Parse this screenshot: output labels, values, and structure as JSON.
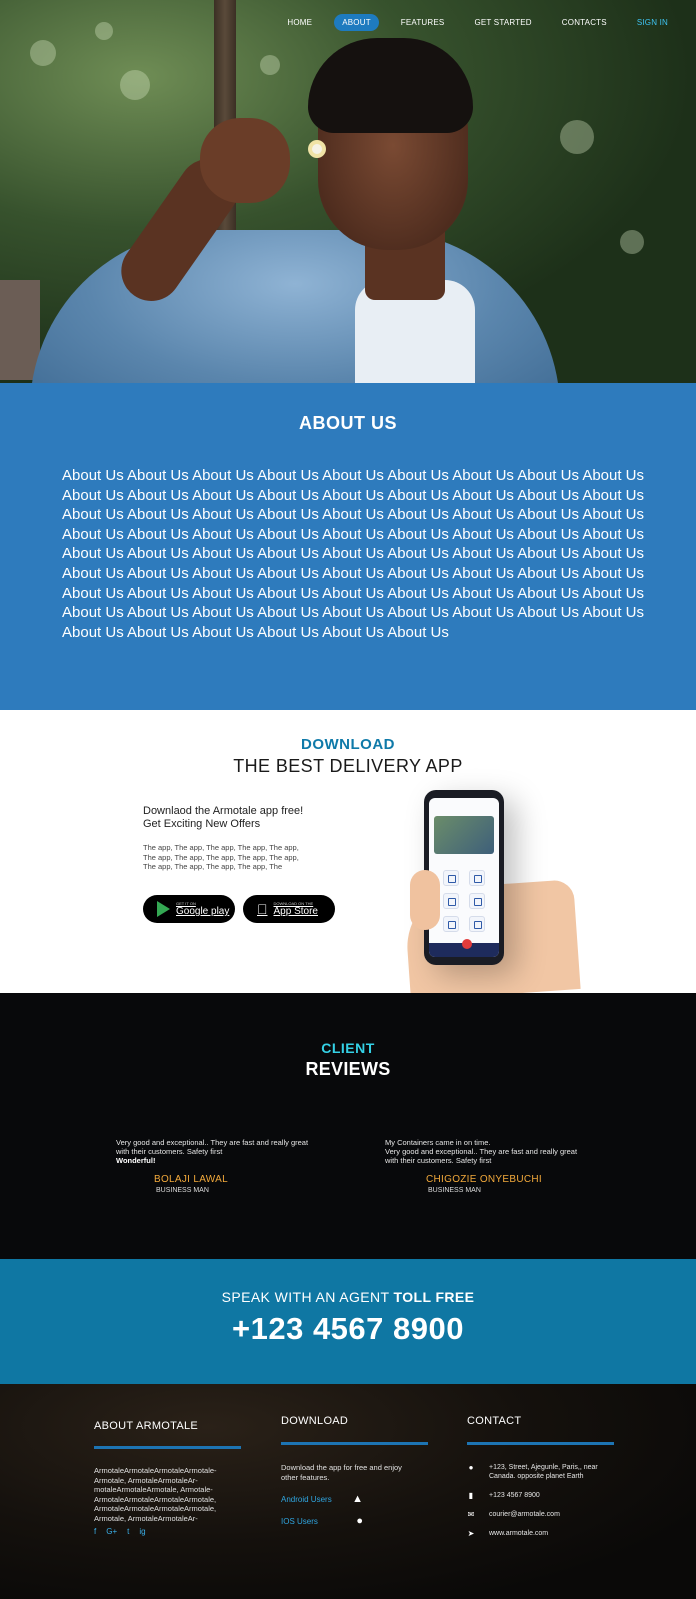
{
  "nav": {
    "items": [
      "HOME",
      "ABOUT",
      "FEATURES",
      "GET STARTED",
      "CONTACTS"
    ],
    "active": "ABOUT",
    "signin": "SIGN IN"
  },
  "about": {
    "title": "ABOUT US",
    "body": "About Us About Us About Us About Us About Us About Us About Us About Us About Us About Us About Us About Us About Us About Us About Us About Us About Us About Us About Us About Us About Us About Us About Us About Us About Us About Us About Us About Us About Us About Us About Us About Us About Us About Us About Us About Us About Us About Us About Us About Us About Us About Us About Us About Us About Us About Us About Us About Us About Us About Us About Us About Us About Us About Us About Us About Us About Us About Us About Us About Us About Us About Us About Us About Us About Us About Us About Us About Us About Us About Us About Us About Us About Us About Us About Us About Us About Us About Us"
  },
  "download": {
    "kicker": "DOWNLOAD",
    "headline": "THE BEST DELIVERY APP",
    "lead_1": "Downlaod the Armotale app free!",
    "lead_2": "Get Exciting New Offers",
    "small": "The app, The app, The app, The app, The app, The app, The app, The app, The app, The app, The app, The app, The app, The app, The",
    "google_small": "GET IT ON",
    "google_big": "Google play",
    "apple_small": "Download on the",
    "apple_big": "App Store"
  },
  "reviews": {
    "kicker": "CLIENT",
    "headline": "REVIEWS",
    "items": [
      {
        "text": "Very good and exceptional.. They are fast and really great with their customers. Safety first",
        "emph": "Wonderful!",
        "name": "BOLAJI LAWAL",
        "role": "BUSINESS MAN"
      },
      {
        "text_1": "My Containers came in on time.",
        "text": "Very good and exceptional.. They are fast and really great with their customers. Safety first",
        "name": "CHIGOZIE ONYEBUCHI",
        "role": "BUSINESS MAN"
      }
    ]
  },
  "call": {
    "line1_plain": "SPEAK WITH AN AGENT ",
    "line1_bold": "TOLL FREE",
    "phone": "+123 4567 8900"
  },
  "footer": {
    "about_title": "ABOUT ARMOTALE",
    "about_text": "ArmotaleArmotaleArmotaleArmotale-Armotale, ArmotaleArmotaleAr-motaleArmotaleArmotale, Armotale-ArmotaleArmotaleArmotaleArmotale, ArmotaleArmotaleArmotaleArmotale, Armotale, ArmotaleArmotaleAr-",
    "socials": [
      "f",
      "G+",
      "t",
      "ig"
    ],
    "download_title": "DOWNLOAD",
    "download_text": "Download the app for free and enjoy other features.",
    "android": "Android Users",
    "ios": "IOS Users",
    "contact_title": "CONTACT",
    "address": "+123,  Street, Ajegunle, Paris,, near Canada. opposite planet Earth",
    "phone": "+123 4567 8900",
    "email": "courier@armotale.com",
    "web": "www.armotale.com"
  },
  "colors": {
    "about_bg": "#2e7bbd",
    "accent_cyan": "#34d1e6",
    "kicker_blue": "#0f7aa9",
    "review_name": "#f2a93b",
    "call_bg": "#0f77a3",
    "rule_blue": "#1d74b3"
  }
}
